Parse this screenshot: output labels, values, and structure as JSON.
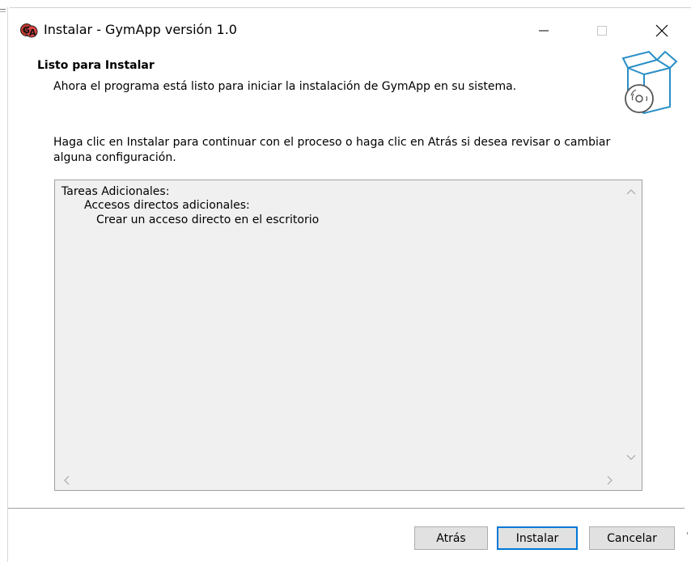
{
  "window": {
    "title": "Instalar - GymApp versión 1.0",
    "app_icon": "gymapp-logo-icon",
    "minimize_icon": "minimize-icon",
    "maximize_icon": "maximize-icon",
    "close_icon": "close-icon"
  },
  "header": {
    "title": "Listo para Instalar",
    "subtitle": "Ahora el programa está listo para iniciar la instalación de GymApp en su sistema.",
    "icon": "install-box-disc-icon"
  },
  "instructions": {
    "line1": "Haga clic en Instalar para continuar con el proceso o haga clic en Atrás si desea revisar o cambiar",
    "line2": "alguna configuración."
  },
  "memo": {
    "lines": [
      "Tareas Adicionales:",
      "Accesos directos adicionales:",
      "Crear un acceso directo en el escritorio"
    ]
  },
  "buttons": {
    "back": "Atrás",
    "install": "Instalar",
    "cancel": "Cancelar"
  },
  "colors": {
    "focus_border": "#0078d7",
    "button_bg": "#e1e1e1",
    "memo_bg": "#f0f0f0"
  }
}
